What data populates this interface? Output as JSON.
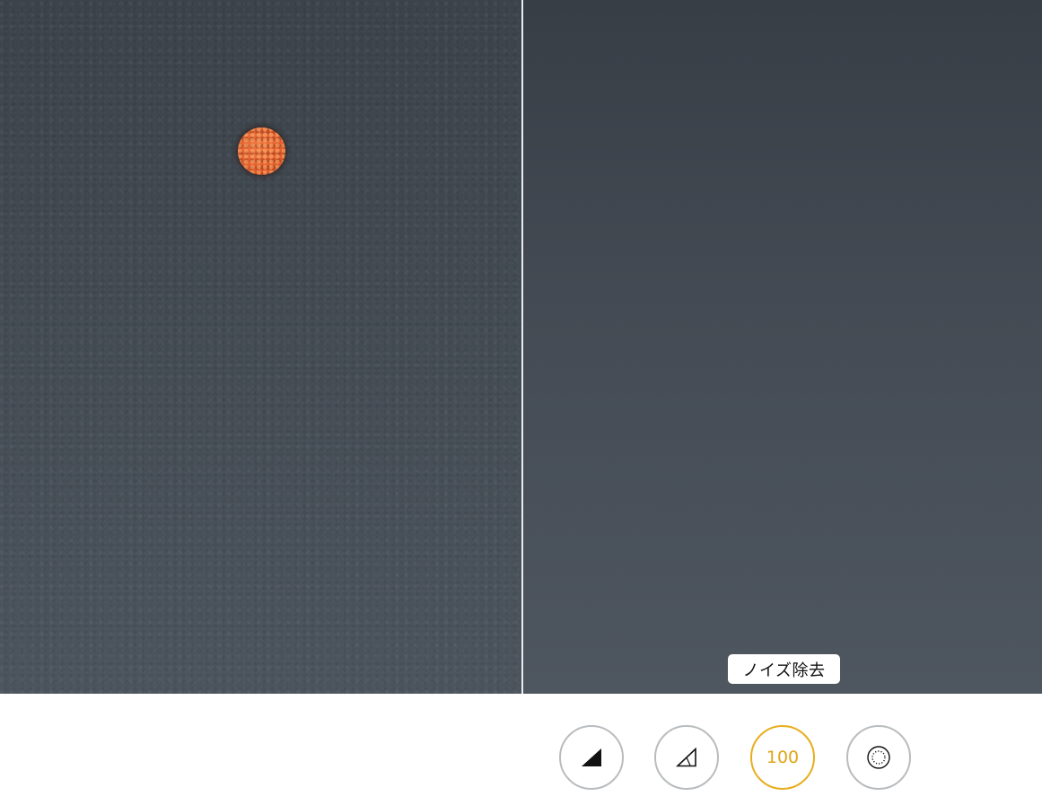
{
  "effect_label": "ノイズ除去",
  "toolbar": {
    "buttons": [
      {
        "icon": "filled-triangle-icon"
      },
      {
        "icon": "outline-triangle-icon"
      },
      {
        "icon": "noise-reduction-value",
        "value": "100"
      },
      {
        "icon": "dotted-circle-icon"
      }
    ]
  },
  "colors": {
    "active_accent": "#e8ad1d",
    "inactive_ring": "#b9bcbf",
    "divider": "#e8ecef"
  }
}
